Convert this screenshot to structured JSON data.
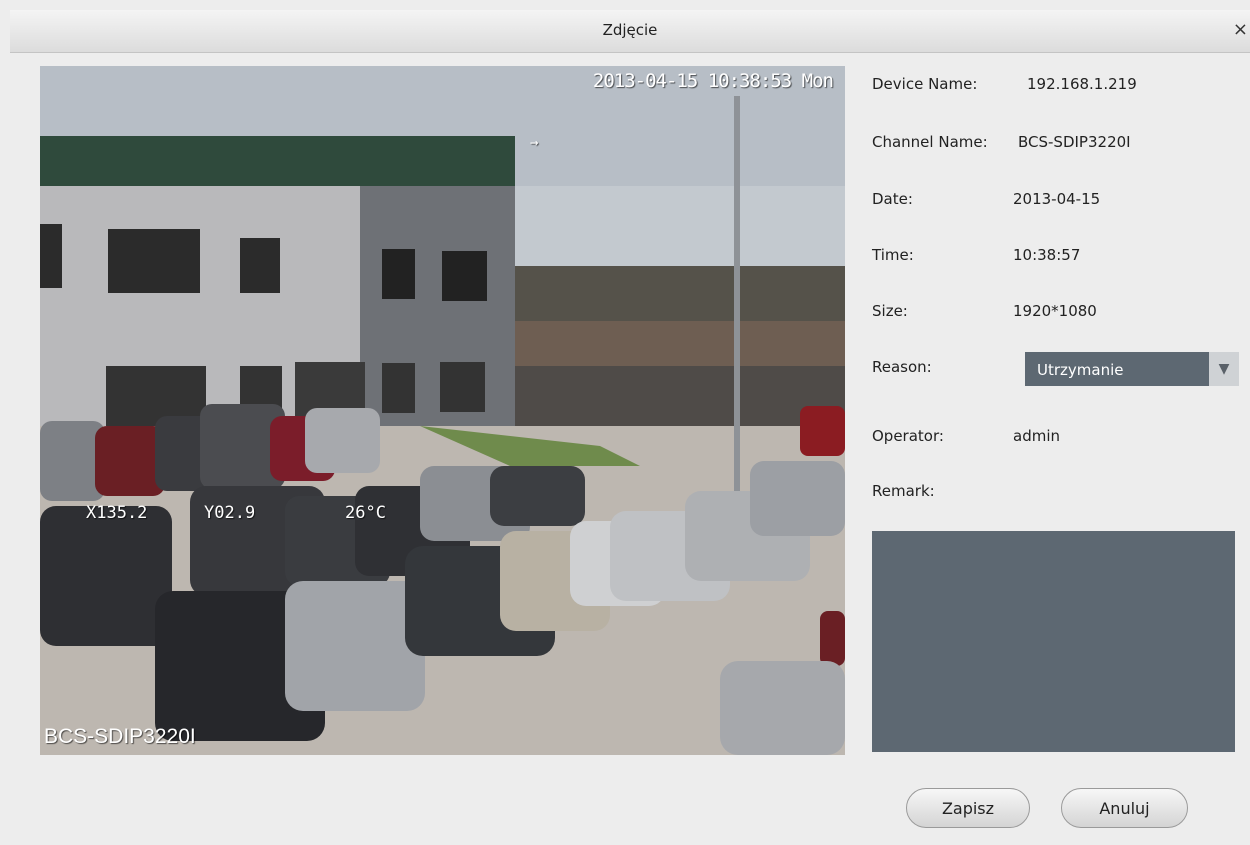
{
  "window": {
    "title": "Zdjęcie",
    "close_symbol": "×"
  },
  "snapshot": {
    "osd_timestamp": "2013-04-15 10:38:53 Mon",
    "osd_channel": "BCS-SDIP3220I",
    "osd_stat_1": "X135.2",
    "osd_stat_2": "Y02.9",
    "osd_stat_3": "26°C",
    "osd_arrow": "→"
  },
  "info": {
    "device_name_label": "Device Name:",
    "device_name": "192.168.1.219",
    "channel_name_label": "Channel Name:",
    "channel_name": "BCS-SDIP3220I",
    "date_label": "Date:",
    "date": "2013-04-15",
    "time_label": "Time:",
    "time": "10:38:57",
    "size_label": "Size:",
    "size": "1920*1080",
    "reason_label": "Reason:",
    "reason_value": "Utrzymanie",
    "operator_label": "Operator:",
    "operator": "admin",
    "remark_label": "Remark:",
    "remark_value": ""
  },
  "buttons": {
    "save": "Zapisz",
    "cancel": "Anuluj"
  },
  "icons": {
    "dropdown": "chevron-down-icon",
    "close": "close-icon"
  },
  "colors": {
    "panel": "#5d6872",
    "background": "#ededed"
  }
}
